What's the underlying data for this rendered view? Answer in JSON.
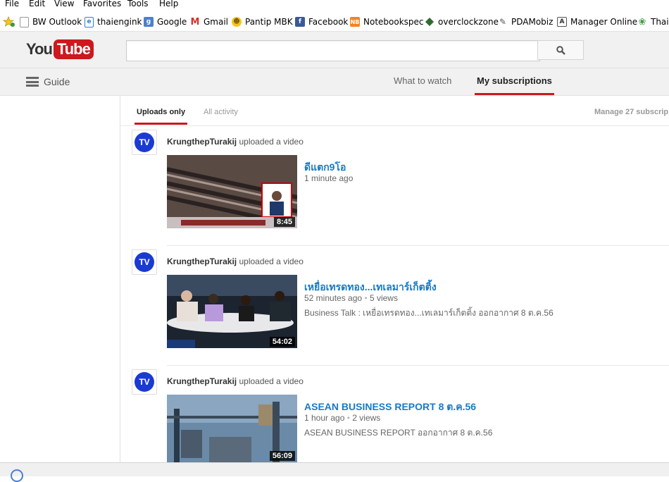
{
  "menu": [
    "File",
    "Edit",
    "View",
    "Favorites",
    "Tools",
    "Help"
  ],
  "favorites": [
    {
      "label": "BW Outlook",
      "icon": "page-icon",
      "color": "#3a7bd5"
    },
    {
      "label": "thaiengink",
      "icon": "ie-page-icon",
      "color": "#3a7bd5"
    },
    {
      "label": "Google",
      "icon": "google-icon",
      "color": "#4a7fd4"
    },
    {
      "label": "Gmail",
      "icon": "gmail-icon",
      "color": "#d93025"
    },
    {
      "label": "Pantip MBK",
      "icon": "smiley-icon",
      "color": "#f5c518"
    },
    {
      "label": "Facebook",
      "icon": "facebook-icon",
      "color": "#3b5998"
    },
    {
      "label": "Notebookspec",
      "icon": "nb-icon",
      "color": "#f58220"
    },
    {
      "label": "overclockzone",
      "icon": "diamond-icon",
      "color": "#2e6b2e"
    },
    {
      "label": "PDAMobiz",
      "icon": "pda-icon",
      "color": "#555555"
    },
    {
      "label": "Manager Online",
      "icon": "manager-icon",
      "color": "#555555"
    },
    {
      "label": "Thair",
      "icon": "thai-icon",
      "color": "#3c9a3c"
    }
  ],
  "masthead": {
    "logo_you": "You",
    "logo_tube": "Tube",
    "search_placeholder": ""
  },
  "guide": {
    "label": "Guide"
  },
  "tabs": {
    "what_to_watch": "What to watch",
    "my_subscriptions": "My subscriptions"
  },
  "feed_tabs": {
    "uploads_only": "Uploads only",
    "all_activity": "All activity",
    "manage": "Manage 27 subscrip"
  },
  "avatar_text": "TV",
  "items": [
    {
      "channel": "KrungthepTurakij",
      "action": "uploaded a video",
      "title": "ดีแตก9โอ",
      "age": "1 minute ago",
      "views": "",
      "description": "",
      "duration": "8:45"
    },
    {
      "channel": "KrungthepTurakij",
      "action": "uploaded a video",
      "title": "เหยื่อเทรดทอง...เทเลมาร์เก็ตติ้ง",
      "age": "52 minutes ago",
      "views": "5 views",
      "description": "Business Talk : เหยื่อเทรดทอง...เทเลมาร์เก็ตติ้ง ออกอากาศ 8 ต.ค.56",
      "duration": "54:02"
    },
    {
      "channel": "KrungthepTurakij",
      "action": "uploaded a video",
      "title": "ASEAN BUSINESS REPORT 8 ต.ค.56",
      "age": "1 hour ago",
      "views": "2 views",
      "description": "ASEAN BUSINESS REPORT ออกอากาศ 8 ต.ค.56",
      "duration": "56:09"
    }
  ],
  "colors": {
    "accent_red": "#cc181e",
    "link_blue": "#167ac6",
    "avatar_blue": "#1a3bd1"
  }
}
